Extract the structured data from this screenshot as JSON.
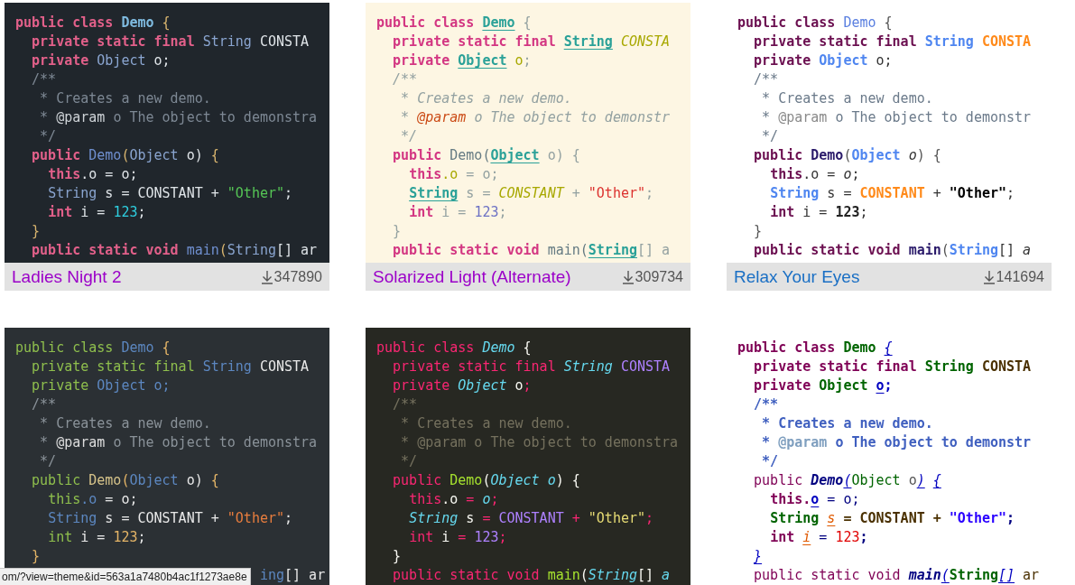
{
  "themes": [
    {
      "color": "#20262c",
      "title": "Ladies Night 2",
      "visited": true,
      "downloads": "347890",
      "lines": [
        [
          {
            "text": "public class ",
            "color": "#e2608a",
            "kind": "bold"
          },
          {
            "text": "Demo",
            "color": "#7fbbe0",
            "kind": "bold"
          },
          {
            "text": " {",
            "color": "#d9b56f",
            "kind": "plain"
          }
        ],
        [
          {
            "text": "  private static final ",
            "color": "#e2608a",
            "kind": "bold"
          },
          {
            "text": "String",
            "color": "#8aa5d0",
            "kind": "plain"
          },
          {
            "text": " CONSTA",
            "color": "#dfe4e8",
            "kind": "plain"
          }
        ],
        [
          {
            "text": "  private ",
            "color": "#e2608a",
            "kind": "bold"
          },
          {
            "text": "Object",
            "color": "#8aa5d0",
            "kind": "plain"
          },
          {
            "text": " o;",
            "color": "#dfe4e8",
            "kind": "plain"
          }
        ],
        [
          {
            "text": "  /**",
            "color": "#7d8894",
            "kind": "plain"
          }
        ],
        [
          {
            "text": "   * Creates a new demo.",
            "color": "#7d8894",
            "kind": "plain"
          }
        ],
        [
          {
            "text": "   * ",
            "color": "#7d8894",
            "kind": "plain"
          },
          {
            "text": "@param",
            "color": "#cdd2d6",
            "kind": "plain"
          },
          {
            "text": " o The object to demonstra",
            "color": "#7d8894",
            "kind": "plain"
          }
        ],
        [
          {
            "text": "   */",
            "color": "#7d8894",
            "kind": "plain"
          }
        ],
        [
          {
            "text": "  public ",
            "color": "#e2608a",
            "kind": "bold"
          },
          {
            "text": "Demo",
            "color": "#6f8fcf",
            "kind": "plain"
          },
          {
            "text": "(",
            "color": "#d9b56f",
            "kind": "plain"
          },
          {
            "text": "Object",
            "color": "#8aa5d0",
            "kind": "plain"
          },
          {
            "text": " o) ",
            "color": "#dfe4e8",
            "kind": "plain"
          },
          {
            "text": "{",
            "color": "#d9b56f",
            "kind": "plain"
          }
        ],
        [
          {
            "text": "    this",
            "color": "#e2608a",
            "kind": "bold"
          },
          {
            "text": ".o = o;",
            "color": "#dfe4e8",
            "kind": "plain"
          }
        ],
        [
          {
            "text": "    String",
            "color": "#8aa5d0",
            "kind": "plain"
          },
          {
            "text": " s = CONSTANT + ",
            "color": "#dfe4e8",
            "kind": "plain"
          },
          {
            "text": "\"Other\"",
            "color": "#55c555",
            "kind": "plain"
          },
          {
            "text": ";",
            "color": "#dfe4e8",
            "kind": "plain"
          }
        ],
        [
          {
            "text": "    int ",
            "color": "#e2608a",
            "kind": "bold"
          },
          {
            "text": "i = ",
            "color": "#dfe4e8",
            "kind": "plain"
          },
          {
            "text": "123",
            "color": "#2ecfe0",
            "kind": "plain"
          },
          {
            "text": ";",
            "color": "#dfe4e8",
            "kind": "plain"
          }
        ],
        [
          {
            "text": "  }",
            "color": "#d9b56f",
            "kind": "plain"
          }
        ],
        [
          {
            "text": "  public static void ",
            "color": "#e2608a",
            "kind": "bold"
          },
          {
            "text": "main",
            "color": "#6f8fcf",
            "kind": "plain"
          },
          {
            "text": "(",
            "color": "#d9b56f",
            "kind": "plain"
          },
          {
            "text": "String",
            "color": "#8aa5d0",
            "kind": "plain"
          },
          {
            "text": "[] ar",
            "color": "#dfe4e8",
            "kind": "plain"
          }
        ]
      ]
    },
    {
      "color": "#fdf6e3",
      "title": "Solarized Light (Alternate)",
      "visited": true,
      "downloads": "309734",
      "lines": [
        [
          {
            "text": "public class ",
            "color": "#d33682",
            "kind": "bold"
          },
          {
            "text": "Demo",
            "color": "#2aa198",
            "kind": "bold-underline"
          },
          {
            "text": " {",
            "color": "#93a1a1",
            "kind": "plain"
          }
        ],
        [
          {
            "text": "  private static final ",
            "color": "#d33682",
            "kind": "bold"
          },
          {
            "text": "String",
            "color": "#2aa198",
            "kind": "bold-underline"
          },
          {
            "text": " CONSTA",
            "color": "#a8a800",
            "kind": "italic"
          }
        ],
        [
          {
            "text": "  private ",
            "color": "#d33682",
            "kind": "bold"
          },
          {
            "text": "Object",
            "color": "#2aa198",
            "kind": "bold-underline"
          },
          {
            "text": " o",
            "color": "#a8a800",
            "kind": "plain"
          },
          {
            "text": ";",
            "color": "#93a1a1",
            "kind": "plain"
          }
        ],
        [
          {
            "text": "  /**",
            "color": "#93a1a1",
            "kind": "italic"
          }
        ],
        [
          {
            "text": "   * Creates a new demo.",
            "color": "#93a1a1",
            "kind": "italic"
          }
        ],
        [
          {
            "text": "   * ",
            "color": "#93a1a1",
            "kind": "italic"
          },
          {
            "text": "@param",
            "color": "#cb4b16",
            "kind": "italic"
          },
          {
            "text": " o The object to demonstr",
            "color": "#93a1a1",
            "kind": "italic"
          }
        ],
        [
          {
            "text": "   */",
            "color": "#93a1a1",
            "kind": "italic"
          }
        ],
        [
          {
            "text": "  public ",
            "color": "#d33682",
            "kind": "bold"
          },
          {
            "text": "Demo(",
            "color": "#657b83",
            "kind": "plain"
          },
          {
            "text": "Object",
            "color": "#2aa198",
            "kind": "bold-underline"
          },
          {
            "text": " o) {",
            "color": "#93a1a1",
            "kind": "plain"
          }
        ],
        [
          {
            "text": "    this",
            "color": "#d33682",
            "kind": "bold"
          },
          {
            "text": ".o",
            "color": "#a8a800",
            "kind": "plain"
          },
          {
            "text": " = o;",
            "color": "#93a1a1",
            "kind": "plain"
          }
        ],
        [
          {
            "text": "    String",
            "color": "#2aa198",
            "kind": "bold-underline"
          },
          {
            "text": " s = ",
            "color": "#93a1a1",
            "kind": "plain"
          },
          {
            "text": "CONSTANT",
            "color": "#a8a800",
            "kind": "italic"
          },
          {
            "text": " + ",
            "color": "#93a1a1",
            "kind": "plain"
          },
          {
            "text": "\"Other\"",
            "color": "#dc322f",
            "kind": "plain"
          },
          {
            "text": ";",
            "color": "#93a1a1",
            "kind": "plain"
          }
        ],
        [
          {
            "text": "    int ",
            "color": "#d33682",
            "kind": "bold"
          },
          {
            "text": "i = ",
            "color": "#93a1a1",
            "kind": "plain"
          },
          {
            "text": "123",
            "color": "#6c71c4",
            "kind": "plain"
          },
          {
            "text": ";",
            "color": "#93a1a1",
            "kind": "plain"
          }
        ],
        [
          {
            "text": "  }",
            "color": "#93a1a1",
            "kind": "plain"
          }
        ],
        [
          {
            "text": "  public static void ",
            "color": "#d33682",
            "kind": "bold"
          },
          {
            "text": "main(",
            "color": "#657b83",
            "kind": "plain"
          },
          {
            "text": "String",
            "color": "#2aa198",
            "kind": "bold-underline"
          },
          {
            "text": "[] a",
            "color": "#93a1a1",
            "kind": "plain"
          }
        ]
      ]
    },
    {
      "color": "#ffffff",
      "title": "Relax Your Eyes",
      "visited": false,
      "downloads": "141694",
      "lines": [
        [
          {
            "text": "public class ",
            "color": "#6b0f50",
            "kind": "bold"
          },
          {
            "text": "Demo",
            "color": "#5a7fe0",
            "kind": "plain"
          },
          {
            "text": " {",
            "color": "#555555",
            "kind": "plain"
          }
        ],
        [
          {
            "text": "  private static final ",
            "color": "#6b0f50",
            "kind": "bold"
          },
          {
            "text": "String",
            "color": "#4f86f0",
            "kind": "bold"
          },
          {
            "text": " CONSTA",
            "color": "#ff8a1a",
            "kind": "bold"
          }
        ],
        [
          {
            "text": "  private ",
            "color": "#6b0f50",
            "kind": "bold"
          },
          {
            "text": "Object",
            "color": "#4f86f0",
            "kind": "bold"
          },
          {
            "text": " o;",
            "color": "#333333",
            "kind": "plain"
          }
        ],
        [
          {
            "text": "  /**",
            "color": "#6b7a8a",
            "kind": "plain"
          }
        ],
        [
          {
            "text": "   * Creates a new demo.",
            "color": "#6b7a8a",
            "kind": "plain"
          }
        ],
        [
          {
            "text": "   * ",
            "color": "#6b7a8a",
            "kind": "plain"
          },
          {
            "text": "@param",
            "color": "#8a8a8a",
            "kind": "plain"
          },
          {
            "text": " o The object to demonstr",
            "color": "#6b7a8a",
            "kind": "plain"
          }
        ],
        [
          {
            "text": "   */",
            "color": "#6b7a8a",
            "kind": "plain"
          }
        ],
        [
          {
            "text": "  public ",
            "color": "#6b0f50",
            "kind": "bold"
          },
          {
            "text": "Demo",
            "color": "#2a1a6a",
            "kind": "bold"
          },
          {
            "text": "(",
            "color": "#555555",
            "kind": "plain"
          },
          {
            "text": "Object",
            "color": "#4f86f0",
            "kind": "bold"
          },
          {
            "text": " o",
            "color": "#333333",
            "kind": "italic"
          },
          {
            "text": ") {",
            "color": "#555555",
            "kind": "plain"
          }
        ],
        [
          {
            "text": "    this",
            "color": "#6b0f50",
            "kind": "bold"
          },
          {
            "text": ".o = ",
            "color": "#333333",
            "kind": "plain"
          },
          {
            "text": "o",
            "color": "#333333",
            "kind": "italic"
          },
          {
            "text": ";",
            "color": "#333333",
            "kind": "plain"
          }
        ],
        [
          {
            "text": "    String",
            "color": "#4f86f0",
            "kind": "bold"
          },
          {
            "text": " s = ",
            "color": "#333333",
            "kind": "plain"
          },
          {
            "text": "CONSTANT",
            "color": "#ff8a1a",
            "kind": "bold"
          },
          {
            "text": " + ",
            "color": "#333333",
            "kind": "plain"
          },
          {
            "text": "\"Other\"",
            "color": "#000000",
            "kind": "bold"
          },
          {
            "text": ";",
            "color": "#333333",
            "kind": "plain"
          }
        ],
        [
          {
            "text": "    int ",
            "color": "#6b0f50",
            "kind": "bold"
          },
          {
            "text": "i = ",
            "color": "#333333",
            "kind": "plain"
          },
          {
            "text": "123",
            "color": "#222222",
            "kind": "bold"
          },
          {
            "text": ";",
            "color": "#333333",
            "kind": "plain"
          }
        ],
        [
          {
            "text": "  }",
            "color": "#555555",
            "kind": "plain"
          }
        ],
        [
          {
            "text": "  public static void ",
            "color": "#6b0f50",
            "kind": "bold"
          },
          {
            "text": "main",
            "color": "#2a1a6a",
            "kind": "bold"
          },
          {
            "text": "(",
            "color": "#555555",
            "kind": "plain"
          },
          {
            "text": "String",
            "color": "#4f86f0",
            "kind": "bold"
          },
          {
            "text": "[] ",
            "color": "#333333",
            "kind": "plain"
          },
          {
            "text": "a",
            "color": "#333333",
            "kind": "italic"
          }
        ]
      ]
    },
    {
      "color": "#2b3034",
      "lines": [
        [
          {
            "text": "public class ",
            "color": "#8fbf4d",
            "kind": "plain"
          },
          {
            "text": "Demo",
            "color": "#5c87c0",
            "kind": "plain"
          },
          {
            "text": " {",
            "color": "#e5b567",
            "kind": "plain"
          }
        ],
        [
          {
            "text": "  private static final ",
            "color": "#8fbf4d",
            "kind": "plain"
          },
          {
            "text": "String",
            "color": "#5c87c0",
            "kind": "plain"
          },
          {
            "text": " CONSTA",
            "color": "#e8e8e8",
            "kind": "plain"
          }
        ],
        [
          {
            "text": "  private ",
            "color": "#8fbf4d",
            "kind": "plain"
          },
          {
            "text": "Object o;",
            "color": "#5c87c0",
            "kind": "plain"
          }
        ],
        [
          {
            "text": "  /**",
            "color": "#8a9299",
            "kind": "plain"
          }
        ],
        [
          {
            "text": "   * Creates a new demo.",
            "color": "#8a9299",
            "kind": "plain"
          }
        ],
        [
          {
            "text": "   * ",
            "color": "#8a9299",
            "kind": "plain"
          },
          {
            "text": "@param",
            "color": "#dddddd",
            "kind": "plain"
          },
          {
            "text": " o The object to demonstra",
            "color": "#8a9299",
            "kind": "plain"
          }
        ],
        [
          {
            "text": "   */",
            "color": "#8a9299",
            "kind": "plain"
          }
        ],
        [
          {
            "text": "  public ",
            "color": "#8fbf4d",
            "kind": "plain"
          },
          {
            "text": "Demo",
            "color": "#d6c38a",
            "kind": "plain"
          },
          {
            "text": "(",
            "color": "#e5b567",
            "kind": "plain"
          },
          {
            "text": "Object",
            "color": "#5c87c0",
            "kind": "plain"
          },
          {
            "text": " o) ",
            "color": "#e8e8e8",
            "kind": "plain"
          },
          {
            "text": "{",
            "color": "#e5b567",
            "kind": "plain"
          }
        ],
        [
          {
            "text": "    this",
            "color": "#8fbf4d",
            "kind": "plain"
          },
          {
            "text": ".o",
            "color": "#5c87c0",
            "kind": "plain"
          },
          {
            "text": " = o;",
            "color": "#e8e8e8",
            "kind": "plain"
          }
        ],
        [
          {
            "text": "    String",
            "color": "#5c87c0",
            "kind": "plain"
          },
          {
            "text": " s = CONSTANT + ",
            "color": "#e8e8e8",
            "kind": "plain"
          },
          {
            "text": "\"Other\"",
            "color": "#e87d3e",
            "kind": "plain"
          },
          {
            "text": ";",
            "color": "#e8e8e8",
            "kind": "plain"
          }
        ],
        [
          {
            "text": "    int ",
            "color": "#8fbf4d",
            "kind": "plain"
          },
          {
            "text": "i = ",
            "color": "#e8e8e8",
            "kind": "plain"
          },
          {
            "text": "123",
            "color": "#e5b567",
            "kind": "plain"
          },
          {
            "text": ";",
            "color": "#e8e8e8",
            "kind": "plain"
          }
        ],
        [
          {
            "text": "  }",
            "color": "#e5b567",
            "kind": "plain"
          }
        ],
        [
          {
            "text": "ing",
            "color": "#5c87c0",
            "kind": "plain"
          },
          {
            "text": "[] ar",
            "color": "#e8e8e8",
            "kind": "plain"
          }
        ]
      ]
    },
    {
      "color": "#272822",
      "lines": [
        [
          {
            "text": "public class ",
            "color": "#f92672",
            "kind": "plain"
          },
          {
            "text": "Demo",
            "color": "#66d9ef",
            "kind": "italic"
          },
          {
            "text": " {",
            "color": "#f8f8f2",
            "kind": "plain"
          }
        ],
        [
          {
            "text": "  private static final ",
            "color": "#f92672",
            "kind": "plain"
          },
          {
            "text": "String",
            "color": "#66d9ef",
            "kind": "italic"
          },
          {
            "text": " CONSTA",
            "color": "#ae81ff",
            "kind": "plain"
          }
        ],
        [
          {
            "text": "  private ",
            "color": "#f92672",
            "kind": "plain"
          },
          {
            "text": "Object",
            "color": "#66d9ef",
            "kind": "italic"
          },
          {
            "text": " o",
            "color": "#f8f8f2",
            "kind": "plain"
          },
          {
            "text": ";",
            "color": "#f92672",
            "kind": "plain"
          }
        ],
        [
          {
            "text": "  /**",
            "color": "#75715e",
            "kind": "plain"
          }
        ],
        [
          {
            "text": "   * Creates a new demo.",
            "color": "#75715e",
            "kind": "plain"
          }
        ],
        [
          {
            "text": "   * @param o The object to demonstra",
            "color": "#75715e",
            "kind": "plain"
          }
        ],
        [
          {
            "text": "   */",
            "color": "#75715e",
            "kind": "plain"
          }
        ],
        [
          {
            "text": "  public ",
            "color": "#f92672",
            "kind": "plain"
          },
          {
            "text": "Demo",
            "color": "#a6e22e",
            "kind": "plain"
          },
          {
            "text": "(",
            "color": "#f8f8f2",
            "kind": "plain"
          },
          {
            "text": "Object o",
            "color": "#66d9ef",
            "kind": "italic"
          },
          {
            "text": ") {",
            "color": "#f8f8f2",
            "kind": "plain"
          }
        ],
        [
          {
            "text": "    this",
            "color": "#f92672",
            "kind": "plain"
          },
          {
            "text": ".o",
            "color": "#f8f8f2",
            "kind": "plain"
          },
          {
            "text": " = ",
            "color": "#f92672",
            "kind": "plain"
          },
          {
            "text": "o",
            "color": "#66d9ef",
            "kind": "italic"
          },
          {
            "text": ";",
            "color": "#f92672",
            "kind": "plain"
          }
        ],
        [
          {
            "text": "    String",
            "color": "#66d9ef",
            "kind": "italic"
          },
          {
            "text": " s ",
            "color": "#f8f8f2",
            "kind": "plain"
          },
          {
            "text": "= ",
            "color": "#f92672",
            "kind": "plain"
          },
          {
            "text": "CONSTANT",
            "color": "#ae81ff",
            "kind": "plain"
          },
          {
            "text": " + ",
            "color": "#f92672",
            "kind": "plain"
          },
          {
            "text": "\"Other\"",
            "color": "#e6db74",
            "kind": "plain"
          },
          {
            "text": ";",
            "color": "#f92672",
            "kind": "plain"
          }
        ],
        [
          {
            "text": "    int ",
            "color": "#f92672",
            "kind": "plain"
          },
          {
            "text": "i",
            "color": "#f8f8f2",
            "kind": "plain"
          },
          {
            "text": " = ",
            "color": "#f92672",
            "kind": "plain"
          },
          {
            "text": "123",
            "color": "#ae81ff",
            "kind": "plain"
          },
          {
            "text": ";",
            "color": "#f92672",
            "kind": "plain"
          }
        ],
        [
          {
            "text": "  }",
            "color": "#f8f8f2",
            "kind": "plain"
          }
        ],
        [
          {
            "text": "  public static void ",
            "color": "#f92672",
            "kind": "plain"
          },
          {
            "text": "main",
            "color": "#a6e22e",
            "kind": "plain"
          },
          {
            "text": "(",
            "color": "#f8f8f2",
            "kind": "plain"
          },
          {
            "text": "String",
            "color": "#66d9ef",
            "kind": "italic"
          },
          {
            "text": "[] ",
            "color": "#f8f8f2",
            "kind": "plain"
          },
          {
            "text": "a",
            "color": "#66d9ef",
            "kind": "italic"
          }
        ]
      ]
    },
    {
      "color": "#ffffff",
      "lines": [
        [
          {
            "text": "public class ",
            "color": "#7f0055",
            "kind": "bold"
          },
          {
            "text": "Demo",
            "color": "#006400",
            "kind": "bold"
          },
          {
            "text": " {",
            "color": "#0000c0",
            "kind": "italic-underline"
          }
        ],
        [
          {
            "text": "  private static final ",
            "color": "#7f0055",
            "kind": "bold"
          },
          {
            "text": "String",
            "color": "#006400",
            "kind": "bold"
          },
          {
            "text": " CONSTA",
            "color": "#4a3000",
            "kind": "bold"
          }
        ],
        [
          {
            "text": "  private ",
            "color": "#7f0055",
            "kind": "bold"
          },
          {
            "text": "Object",
            "color": "#006400",
            "kind": "bold"
          },
          {
            "text": " o",
            "color": "#0000c0",
            "kind": "bold-underline"
          },
          {
            "text": ";",
            "color": "#0000c0",
            "kind": "bold"
          }
        ],
        [
          {
            "text": "  /**",
            "color": "#3f5fbf",
            "kind": "bold"
          }
        ],
        [
          {
            "text": "   * Creates a new demo.",
            "color": "#3f5fbf",
            "kind": "bold"
          }
        ],
        [
          {
            "text": "   * ",
            "color": "#3f5fbf",
            "kind": "bold"
          },
          {
            "text": "@param",
            "color": "#7f9fbf",
            "kind": "bold"
          },
          {
            "text": " o The object to demonstr",
            "color": "#3f5fbf",
            "kind": "bold"
          }
        ],
        [
          {
            "text": "   */",
            "color": "#3f5fbf",
            "kind": "bold"
          }
        ],
        [
          {
            "text": "  public ",
            "color": "#7f0055",
            "kind": "plain"
          },
          {
            "text": "Demo",
            "color": "#000080",
            "kind": "bold-italic"
          },
          {
            "text": "(",
            "color": "#0000c0",
            "kind": "italic-underline"
          },
          {
            "text": "Object",
            "color": "#006400",
            "kind": "plain"
          },
          {
            "text": " o",
            "color": "#555555",
            "kind": "plain"
          },
          {
            "text": ")",
            "color": "#0000c0",
            "kind": "italic-underline"
          },
          {
            "text": " {",
            "color": "#0000c0",
            "kind": "italic-underline"
          }
        ],
        [
          {
            "text": "    this.",
            "color": "#7f0055",
            "kind": "bold"
          },
          {
            "text": "o",
            "color": "#0000c0",
            "kind": "bold-underline"
          },
          {
            "text": " = o;",
            "color": "#000080",
            "kind": "plain"
          }
        ],
        [
          {
            "text": "    String ",
            "color": "#006400",
            "kind": "bold"
          },
          {
            "text": "s",
            "color": "#e05a00",
            "kind": "italic-underline"
          },
          {
            "text": " = CONSTANT + ",
            "color": "#4a3000",
            "kind": "bold"
          },
          {
            "text": "\"Other\"",
            "color": "#2a00ff",
            "kind": "bold"
          },
          {
            "text": ";",
            "color": "#000080",
            "kind": "bold"
          }
        ],
        [
          {
            "text": "    int ",
            "color": "#7f0055",
            "kind": "bold"
          },
          {
            "text": "i",
            "color": "#e05a00",
            "kind": "italic-underline"
          },
          {
            "text": " = ",
            "color": "#000080",
            "kind": "plain"
          },
          {
            "text": "123",
            "color": "#e00000",
            "kind": "plain"
          },
          {
            "text": ";",
            "color": "#000080",
            "kind": "bold"
          }
        ],
        [
          {
            "text": "  }",
            "color": "#0000c0",
            "kind": "italic-underline"
          }
        ],
        [
          {
            "text": "  public static void ",
            "color": "#7f0055",
            "kind": "plain"
          },
          {
            "text": "main",
            "color": "#000080",
            "kind": "bold-italic"
          },
          {
            "text": "(",
            "color": "#0000c0",
            "kind": "italic-underline"
          },
          {
            "text": "String",
            "color": "#006400",
            "kind": "bold"
          },
          {
            "text": "[]",
            "color": "#0000c0",
            "kind": "italic-underline"
          },
          {
            "text": " ar",
            "color": "#4a3000",
            "kind": "plain"
          }
        ]
      ]
    }
  ],
  "status_bar": {
    "url": "om/?view=theme&id=563a1a7480b4ac1f1273ae8e"
  }
}
